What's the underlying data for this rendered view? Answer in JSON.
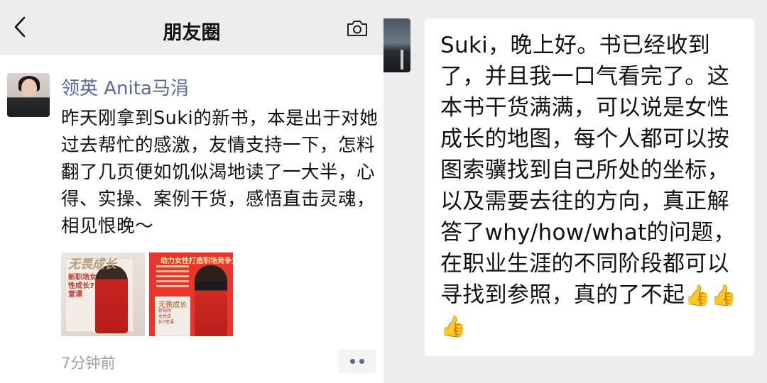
{
  "header": {
    "title": "朋友圈",
    "back_icon": "chevron-left-icon",
    "camera_icon": "camera-icon"
  },
  "post": {
    "author": "领英 Anita马涓",
    "text": "昨天刚拿到Suki的新书，本是出于对她过去帮忙的感激，友情支持一下，怎料翻了几页便如饥似渴地读了一大半，心得、实操、案例干货，感悟直击灵魂，相见恨晚～",
    "images": [
      {
        "title": "无畏成长",
        "subtitle": "新职场女性成长7堂课"
      },
      {
        "headline": "助力女性打造职场竞争力",
        "title": "无畏成长",
        "subtitle": "新职场女性成长7堂课"
      }
    ],
    "timestamp": "7分钟前",
    "more_icon": "more-dots-icon"
  },
  "chat": {
    "message": "Suki，晚上好。书已经收到了，并且我一口气看完了。这本书干货满满，可以说是女性成长的地图，每个人都可以按图索骥找到自己所处的坐标，以及需要去往的方向，真正解答了why/how/what的问题，在职业生涯的不同阶段都可以寻找到参照，真的了不起",
    "emojis": [
      "👍",
      "👍",
      "👍"
    ]
  },
  "colors": {
    "link_blue": "#576b95",
    "background": "#ededed",
    "timestamp_gray": "#a0a0a0"
  }
}
